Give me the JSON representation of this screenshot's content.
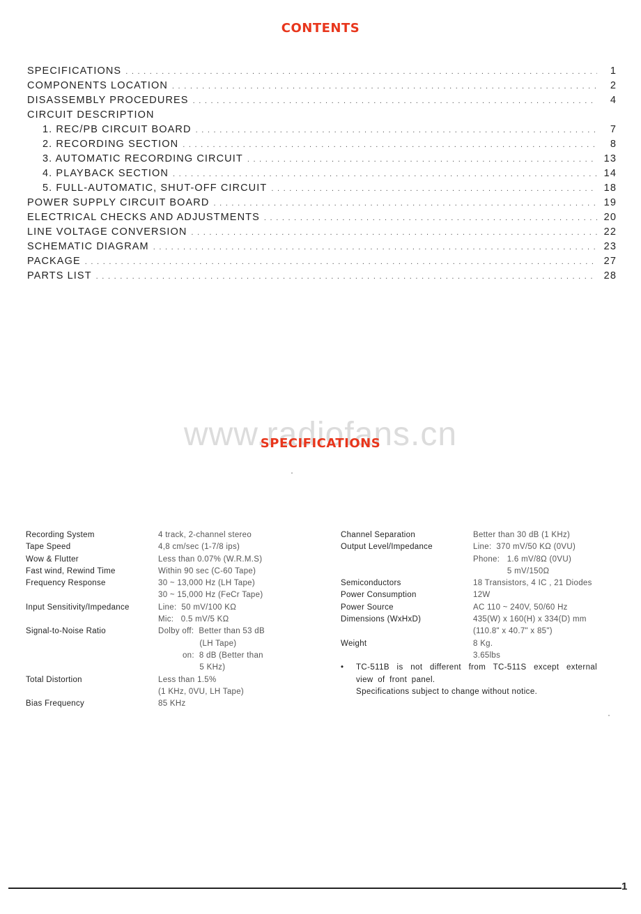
{
  "watermark": "www.radiofans.cn",
  "contents": {
    "title": "CONTENTS",
    "items": [
      {
        "label": "SPECIFICATIONS",
        "page": "1",
        "sub": false
      },
      {
        "label": "COMPONENTS LOCATION",
        "page": "2",
        "sub": false
      },
      {
        "label": "DISASSEMBLY PROCEDURES",
        "page": "4",
        "sub": false
      },
      {
        "label": "CIRCUIT DESCRIPTION",
        "page": "",
        "sub": false
      },
      {
        "label": "1. REC/PB CIRCUIT BOARD",
        "page": "7",
        "sub": true
      },
      {
        "label": "2. RECORDING SECTION",
        "page": "8",
        "sub": true
      },
      {
        "label": "3. AUTOMATIC RECORDING CIRCUIT",
        "page": "13",
        "sub": true
      },
      {
        "label": "4. PLAYBACK SECTION",
        "page": "14",
        "sub": true
      },
      {
        "label": "5. FULL-AUTOMATIC, SHUT-OFF CIRCUIT",
        "page": "18",
        "sub": true
      },
      {
        "label": "POWER SUPPLY CIRCUIT BOARD",
        "page": "19",
        "sub": false
      },
      {
        "label": "ELECTRICAL CHECKS AND ADJUSTMENTS",
        "page": "20",
        "sub": false
      },
      {
        "label": "LINE VOLTAGE CONVERSION",
        "page": "22",
        "sub": false
      },
      {
        "label": "SCHEMATIC DIAGRAM",
        "page": "23",
        "sub": false
      },
      {
        "label": "PACKAGE",
        "page": "27",
        "sub": false
      },
      {
        "label": "PARTS LIST",
        "page": "28",
        "sub": false
      }
    ]
  },
  "specifications": {
    "title": "SPECIFICATIONS",
    "left": [
      {
        "label": "Recording System",
        "values": [
          "4 track, 2-channel stereo"
        ]
      },
      {
        "label": "Tape Speed",
        "values": [
          "4,8 cm/sec (1-7/8 ips)"
        ]
      },
      {
        "label": "Wow & Flutter",
        "values": [
          "Less than 0.07% (W.R.M.S)"
        ]
      },
      {
        "label": "Fast wind, Rewind Time",
        "values": [
          "Within 90 sec (C-60 Tape)"
        ]
      },
      {
        "label": "Frequency Response",
        "values": [
          "30 ~ 13,000 Hz (LH Tape)",
          "30 ~ 15,000 Hz (FeCr Tape)"
        ]
      },
      {
        "label": "Input Sensitivity/Impedance",
        "values": [
          "Line:  50 mV/100 KΩ",
          "Mic:   0.5 mV/5 KΩ"
        ]
      },
      {
        "label": "Signal-to-Noise Ratio",
        "values": [
          "Dolby off:  Better than 53 dB",
          "                 (LH Tape)",
          "          on:  8 dB (Better than",
          "                 5 KHz)"
        ]
      },
      {
        "label": "Total Distortion",
        "values": [
          "Less than 1.5%",
          "(1 KHz, 0VU, LH Tape)"
        ]
      },
      {
        "label": "Bias Frequency",
        "values": [
          "85 KHz"
        ]
      }
    ],
    "right": [
      {
        "label": "Channel Separation",
        "values": [
          "Better than 30 dB (1 KHz)"
        ]
      },
      {
        "label": "Output Level/Impedance",
        "values": [
          "Line:  370 mV/50 KΩ (0VU)",
          "Phone:   1.6 mV/8Ω (0VU)",
          "              5 mV/150Ω"
        ]
      },
      {
        "label": "Semiconductors",
        "values": [
          "18 Transistors, 4 IC , 21 Diodes"
        ]
      },
      {
        "label": "Power Consumption",
        "values": [
          "12W"
        ]
      },
      {
        "label": "Power Source",
        "values": [
          "AC 110 ~ 240V, 50/60 Hz"
        ]
      },
      {
        "label": "Dimensions (WxHxD)",
        "values": [
          "435(W) x 160(H) x 334(D) mm",
          "(110.8\" x 40.7\" x 85\")"
        ]
      },
      {
        "label": "Weight",
        "values": [
          "8 Kg.",
          "3.65lbs"
        ]
      }
    ],
    "note_bullet": "•",
    "note_line1": "TC-511B is not different from TC-511S except external",
    "note_line2": "view of front panel.",
    "note_line3": "Specifications subject to change without notice."
  },
  "footer": {
    "page_number": "1"
  }
}
